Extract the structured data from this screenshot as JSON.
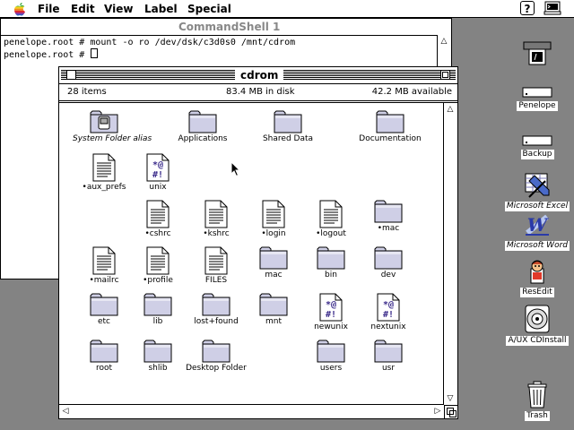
{
  "menubar": {
    "menus": [
      "File",
      "Edit",
      "View",
      "Label",
      "Special"
    ],
    "help": "?"
  },
  "shell": {
    "title": "CommandShell 1",
    "lines": [
      "penelope.root # mount -o ro /dev/dsk/c3d0s0 /mnt/cdrom",
      "penelope.root # "
    ]
  },
  "cdrom": {
    "title": "cdrom",
    "items_count": "28 items",
    "disk_used": "83.4 MB in disk",
    "available": "42.2 MB available",
    "items": [
      {
        "label": "System Folder alias",
        "icon": "system-folder-icon",
        "italic": true
      },
      {
        "label": "Applications",
        "icon": "folder-icon"
      },
      {
        "label": "Shared Data",
        "icon": "folder-icon"
      },
      {
        "label": "Documentation",
        "icon": "folder-icon"
      },
      {
        "label": "•aux_prefs",
        "icon": "document-icon"
      },
      {
        "label": "unix",
        "icon": "executable-icon"
      },
      {
        "label": "•cshrc",
        "icon": "document-icon"
      },
      {
        "label": "•kshrc",
        "icon": "document-icon"
      },
      {
        "label": "•login",
        "icon": "document-icon"
      },
      {
        "label": "•logout",
        "icon": "document-icon"
      },
      {
        "label": "•mac",
        "icon": "folder-icon"
      },
      {
        "label": "•mailrc",
        "icon": "document-icon"
      },
      {
        "label": "•profile",
        "icon": "document-icon"
      },
      {
        "label": "FILES",
        "icon": "document-icon"
      },
      {
        "label": "mac",
        "icon": "folder-icon"
      },
      {
        "label": "bin",
        "icon": "folder-icon"
      },
      {
        "label": "dev",
        "icon": "folder-icon"
      },
      {
        "label": "etc",
        "icon": "folder-icon"
      },
      {
        "label": "lib",
        "icon": "folder-icon"
      },
      {
        "label": "lost+found",
        "icon": "folder-icon"
      },
      {
        "label": "mnt",
        "icon": "folder-icon"
      },
      {
        "label": "newunix",
        "icon": "executable-icon"
      },
      {
        "label": "nextunix",
        "icon": "executable-icon"
      },
      {
        "label": "root",
        "icon": "folder-icon"
      },
      {
        "label": "shlib",
        "icon": "folder-icon"
      },
      {
        "label": "Desktop Folder",
        "icon": "folder-icon"
      },
      {
        "label": "users",
        "icon": "folder-icon"
      },
      {
        "label": "usr",
        "icon": "folder-icon"
      }
    ]
  },
  "desktop": [
    {
      "label": "",
      "icon": "terminal-disk-icon"
    },
    {
      "label": "Penelope",
      "icon": "hard-disk-icon"
    },
    {
      "label": "Backup",
      "icon": "hard-disk-icon"
    },
    {
      "label": "Microsoft Excel",
      "icon": "excel-icon",
      "italic": true
    },
    {
      "label": "Microsoft Word",
      "icon": "word-icon",
      "italic": true
    },
    {
      "label": "ResEdit",
      "icon": "resedit-icon"
    },
    {
      "label": "A/UX CDInstall",
      "icon": "cd-install-icon"
    },
    {
      "label": "Trash",
      "icon": "trash-icon"
    }
  ]
}
